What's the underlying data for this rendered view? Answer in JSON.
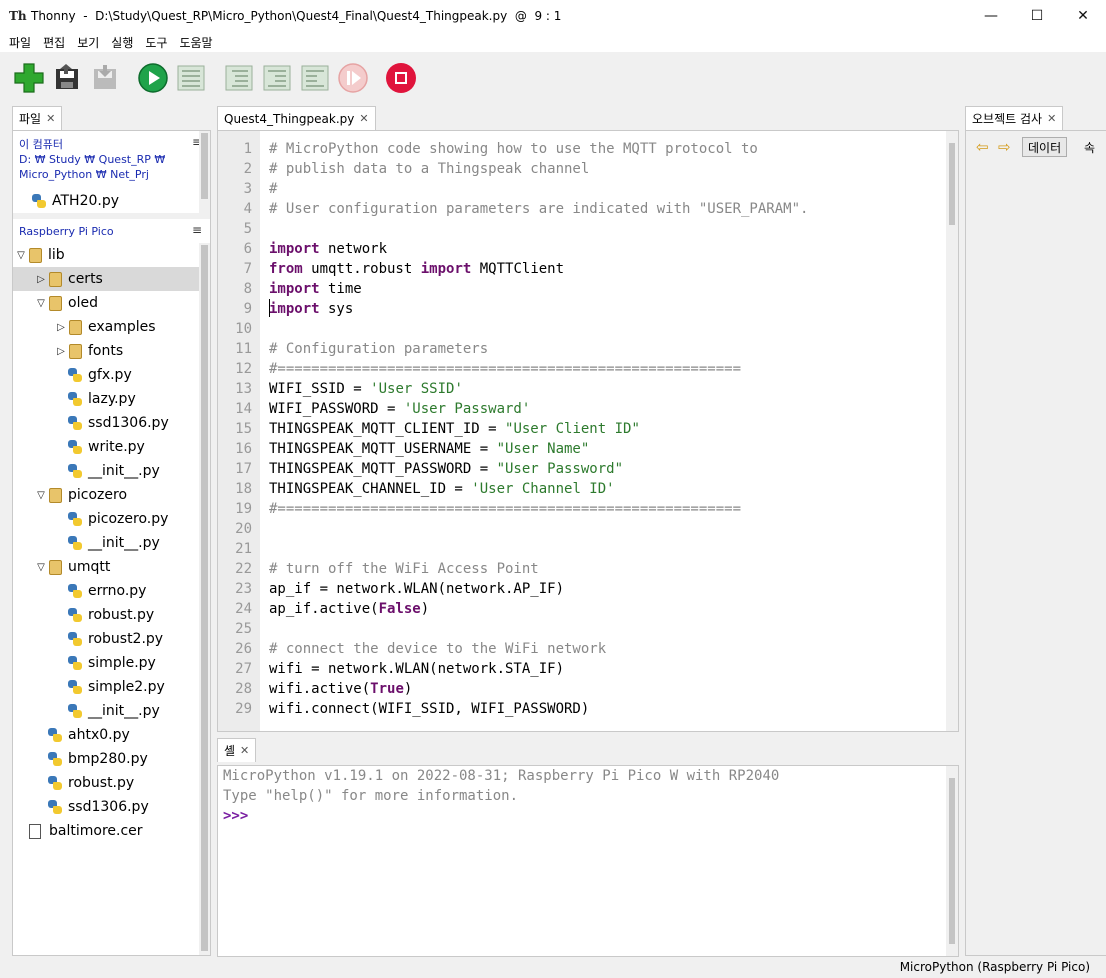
{
  "window": {
    "app_name": "Thonny",
    "title": "Thonny  -  D:\\Study\\Quest_RP\\Micro_Python\\Quest4_Final\\Quest4_Thingpeak.py  @  9 : 1",
    "minimize": "—",
    "maximize": "☐",
    "close": "✕"
  },
  "menu": [
    "파일",
    "편집",
    "보기",
    "실행",
    "도구",
    "도움말"
  ],
  "toolbar": {
    "icons": [
      "new-file-icon",
      "open-file-icon",
      "save-file-icon",
      "run-icon",
      "debug-icon",
      "step-over-icon",
      "step-into-icon",
      "step-out-icon",
      "resume-icon",
      "stop-icon"
    ],
    "colors": {
      "new": "#2fa82f",
      "run": "#1fa34a",
      "stop": "#e0143c"
    }
  },
  "files_panel": {
    "tab_label": "파일",
    "computer_header": "이 컴퓨터",
    "computer_path": "D: ₩ Study ₩ Quest_RP ₩ Micro_Python ₩ Net_Prj",
    "computer_files": [
      "ATH20.py"
    ],
    "device_header": "Raspberry Pi Pico",
    "menu_glyph": "≡",
    "tree": [
      {
        "label": "lib",
        "type": "folder",
        "depth": 0,
        "expanded": true
      },
      {
        "label": "certs",
        "type": "folder",
        "depth": 1,
        "expanded": false,
        "selected": true
      },
      {
        "label": "oled",
        "type": "folder",
        "depth": 1,
        "expanded": true
      },
      {
        "label": "examples",
        "type": "folder",
        "depth": 2,
        "expanded": false
      },
      {
        "label": "fonts",
        "type": "folder",
        "depth": 2,
        "expanded": false
      },
      {
        "label": "gfx.py",
        "type": "py",
        "depth": 2
      },
      {
        "label": "lazy.py",
        "type": "py",
        "depth": 2
      },
      {
        "label": "ssd1306.py",
        "type": "py",
        "depth": 2
      },
      {
        "label": "write.py",
        "type": "py",
        "depth": 2
      },
      {
        "label": "__init__.py",
        "type": "py",
        "depth": 2
      },
      {
        "label": "picozero",
        "type": "folder",
        "depth": 1,
        "expanded": true
      },
      {
        "label": "picozero.py",
        "type": "py",
        "depth": 2
      },
      {
        "label": "__init__.py",
        "type": "py",
        "depth": 2
      },
      {
        "label": "umqtt",
        "type": "folder",
        "depth": 1,
        "expanded": true
      },
      {
        "label": "errno.py",
        "type": "py",
        "depth": 2
      },
      {
        "label": "robust.py",
        "type": "py",
        "depth": 2
      },
      {
        "label": "robust2.py",
        "type": "py",
        "depth": 2
      },
      {
        "label": "simple.py",
        "type": "py",
        "depth": 2
      },
      {
        "label": "simple2.py",
        "type": "py",
        "depth": 2
      },
      {
        "label": "__init__.py",
        "type": "py",
        "depth": 2
      },
      {
        "label": "ahtx0.py",
        "type": "py",
        "depth": 1
      },
      {
        "label": "bmp280.py",
        "type": "py",
        "depth": 1
      },
      {
        "label": "robust.py",
        "type": "py",
        "depth": 1
      },
      {
        "label": "ssd1306.py",
        "type": "py",
        "depth": 1
      },
      {
        "label": "baltimore.cer",
        "type": "file",
        "depth": 0
      }
    ]
  },
  "editor": {
    "tab_label": "Quest4_Thingpeak.py",
    "lines": [
      [
        [
          "c",
          "# MicroPython code showing how to use the MQTT protocol to"
        ]
      ],
      [
        [
          "c",
          "# publish data to a Thingspeak channel"
        ]
      ],
      [
        [
          "c",
          "#"
        ]
      ],
      [
        [
          "c",
          "# User configuration parameters are indicated with \"USER_PARAM\"."
        ]
      ],
      [],
      [
        [
          "k",
          "import"
        ],
        [
          "p",
          " network"
        ]
      ],
      [
        [
          "k",
          "from"
        ],
        [
          "p",
          " umqtt.robust "
        ],
        [
          "k",
          "import"
        ],
        [
          "p",
          " MQTTClient"
        ]
      ],
      [
        [
          "k",
          "import"
        ],
        [
          "p",
          " time"
        ]
      ],
      [
        [
          "k",
          "import"
        ],
        [
          "p",
          " sys"
        ]
      ],
      [],
      [
        [
          "c",
          "# Configuration parameters"
        ]
      ],
      [
        [
          "c",
          "#======================================================="
        ]
      ],
      [
        [
          "p",
          "WIFI_SSID = "
        ],
        [
          "s",
          "'User SSID'"
        ]
      ],
      [
        [
          "p",
          "WIFI_PASSWORD = "
        ],
        [
          "s",
          "'User Passward'"
        ]
      ],
      [
        [
          "p",
          "THINGSPEAK_MQTT_CLIENT_ID = "
        ],
        [
          "s",
          "\"User Client ID\""
        ]
      ],
      [
        [
          "p",
          "THINGSPEAK_MQTT_USERNAME = "
        ],
        [
          "s",
          "\"User Name\""
        ]
      ],
      [
        [
          "p",
          "THINGSPEAK_MQTT_PASSWORD = "
        ],
        [
          "s",
          "\"User Password\""
        ]
      ],
      [
        [
          "p",
          "THINGSPEAK_CHANNEL_ID = "
        ],
        [
          "s",
          "'User Channel ID'"
        ]
      ],
      [
        [
          "c",
          "#======================================================="
        ]
      ],
      [],
      [],
      [
        [
          "c",
          "# turn off the WiFi Access Point"
        ]
      ],
      [
        [
          "p",
          "ap_if = network.WLAN(network.AP_IF)"
        ]
      ],
      [
        [
          "p",
          "ap_if.active("
        ],
        [
          "k",
          "False"
        ],
        [
          "p",
          ")"
        ]
      ],
      [],
      [
        [
          "c",
          "# connect the device to the WiFi network"
        ]
      ],
      [
        [
          "p",
          "wifi = network.WLAN(network.STA_IF)"
        ]
      ],
      [
        [
          "p",
          "wifi.active("
        ],
        [
          "k",
          "True"
        ],
        [
          "p",
          ")"
        ]
      ],
      [
        [
          "p",
          "wifi.connect(WIFI_SSID, WIFI_PASSWORD)"
        ]
      ]
    ]
  },
  "shell": {
    "tab_label": "셸",
    "lines": [
      "MicroPython v1.19.1 on 2022-08-31; Raspberry Pi Pico W with RP2040",
      "Type \"help()\" for more information."
    ],
    "prompt": ">>>"
  },
  "inspector": {
    "tab_label": "오브젝트 검사",
    "data_button": "데이터",
    "attr_button": "속"
  },
  "status": {
    "interpreter": "MicroPython (Raspberry Pi Pico)"
  }
}
